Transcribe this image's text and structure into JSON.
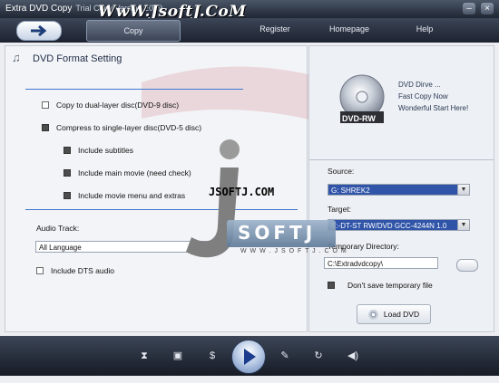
{
  "window": {
    "title": "Extra DVD Copy",
    "subtitle": "Trial Copy Version 2009",
    "watermark_top": "WwW.JsoftJ.CoM"
  },
  "toolbar": {
    "tabs": [
      "Copy",
      "Register",
      "Homepage",
      "Help"
    ]
  },
  "left_panel": {
    "title": "DVD Format Setting",
    "options": [
      {
        "label": "Copy to dual-layer disc(DVD-9 disc)",
        "checked": false
      },
      {
        "label": "Compress to single-layer disc(DVD-5 disc)",
        "checked": true
      },
      {
        "label": "Include subtitles",
        "checked": true
      },
      {
        "label": "Include main movie (need check)",
        "checked": true
      },
      {
        "label": "Include movie menu and extras",
        "checked": true
      }
    ],
    "audio_track_label": "Audio Track:",
    "audio_track_value": "All Language",
    "dts_label": "Include DTS audio",
    "dts_checked": false
  },
  "right_panel": {
    "disc_label": "DVD-RW",
    "blurb": [
      "DVD Dirve ...",
      "Fast Copy Now",
      "Wonderful Start Here!"
    ],
    "source_label": "Source:",
    "source_value": "G: SHREK2",
    "target_label": "Target:",
    "target_value": "E:-DT-ST RW/DVD GCC-4244N 1.0",
    "temp_dir_label": "Temporary Directory:",
    "temp_dir_value": "C:\\Extradvdcopy\\",
    "dont_save_label": "Don't save temporary file",
    "dont_save_checked": true,
    "load_button": "Load DVD"
  },
  "overlay": {
    "site": "JSOFTJ.COM",
    "banner": "SOFTJ",
    "banner_small": "W W W . J S O F T J . C O M"
  },
  "colors": {
    "accent_blue": "#3f78d0",
    "chrome_dark": "#1f2633",
    "selection": "#2f54a8"
  }
}
